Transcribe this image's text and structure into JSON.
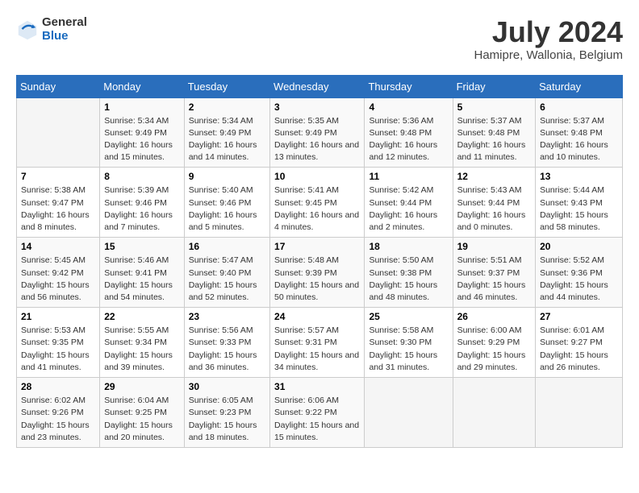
{
  "logo": {
    "general": "General",
    "blue": "Blue"
  },
  "title": {
    "month_year": "July 2024",
    "location": "Hamipre, Wallonia, Belgium"
  },
  "calendar": {
    "headers": [
      "Sunday",
      "Monday",
      "Tuesday",
      "Wednesday",
      "Thursday",
      "Friday",
      "Saturday"
    ],
    "weeks": [
      [
        {
          "day": "",
          "sunrise": "",
          "sunset": "",
          "daylight": ""
        },
        {
          "day": "1",
          "sunrise": "Sunrise: 5:34 AM",
          "sunset": "Sunset: 9:49 PM",
          "daylight": "Daylight: 16 hours and 15 minutes."
        },
        {
          "day": "2",
          "sunrise": "Sunrise: 5:34 AM",
          "sunset": "Sunset: 9:49 PM",
          "daylight": "Daylight: 16 hours and 14 minutes."
        },
        {
          "day": "3",
          "sunrise": "Sunrise: 5:35 AM",
          "sunset": "Sunset: 9:49 PM",
          "daylight": "Daylight: 16 hours and 13 minutes."
        },
        {
          "day": "4",
          "sunrise": "Sunrise: 5:36 AM",
          "sunset": "Sunset: 9:48 PM",
          "daylight": "Daylight: 16 hours and 12 minutes."
        },
        {
          "day": "5",
          "sunrise": "Sunrise: 5:37 AM",
          "sunset": "Sunset: 9:48 PM",
          "daylight": "Daylight: 16 hours and 11 minutes."
        },
        {
          "day": "6",
          "sunrise": "Sunrise: 5:37 AM",
          "sunset": "Sunset: 9:48 PM",
          "daylight": "Daylight: 16 hours and 10 minutes."
        }
      ],
      [
        {
          "day": "7",
          "sunrise": "Sunrise: 5:38 AM",
          "sunset": "Sunset: 9:47 PM",
          "daylight": "Daylight: 16 hours and 8 minutes."
        },
        {
          "day": "8",
          "sunrise": "Sunrise: 5:39 AM",
          "sunset": "Sunset: 9:46 PM",
          "daylight": "Daylight: 16 hours and 7 minutes."
        },
        {
          "day": "9",
          "sunrise": "Sunrise: 5:40 AM",
          "sunset": "Sunset: 9:46 PM",
          "daylight": "Daylight: 16 hours and 5 minutes."
        },
        {
          "day": "10",
          "sunrise": "Sunrise: 5:41 AM",
          "sunset": "Sunset: 9:45 PM",
          "daylight": "Daylight: 16 hours and 4 minutes."
        },
        {
          "day": "11",
          "sunrise": "Sunrise: 5:42 AM",
          "sunset": "Sunset: 9:44 PM",
          "daylight": "Daylight: 16 hours and 2 minutes."
        },
        {
          "day": "12",
          "sunrise": "Sunrise: 5:43 AM",
          "sunset": "Sunset: 9:44 PM",
          "daylight": "Daylight: 16 hours and 0 minutes."
        },
        {
          "day": "13",
          "sunrise": "Sunrise: 5:44 AM",
          "sunset": "Sunset: 9:43 PM",
          "daylight": "Daylight: 15 hours and 58 minutes."
        }
      ],
      [
        {
          "day": "14",
          "sunrise": "Sunrise: 5:45 AM",
          "sunset": "Sunset: 9:42 PM",
          "daylight": "Daylight: 15 hours and 56 minutes."
        },
        {
          "day": "15",
          "sunrise": "Sunrise: 5:46 AM",
          "sunset": "Sunset: 9:41 PM",
          "daylight": "Daylight: 15 hours and 54 minutes."
        },
        {
          "day": "16",
          "sunrise": "Sunrise: 5:47 AM",
          "sunset": "Sunset: 9:40 PM",
          "daylight": "Daylight: 15 hours and 52 minutes."
        },
        {
          "day": "17",
          "sunrise": "Sunrise: 5:48 AM",
          "sunset": "Sunset: 9:39 PM",
          "daylight": "Daylight: 15 hours and 50 minutes."
        },
        {
          "day": "18",
          "sunrise": "Sunrise: 5:50 AM",
          "sunset": "Sunset: 9:38 PM",
          "daylight": "Daylight: 15 hours and 48 minutes."
        },
        {
          "day": "19",
          "sunrise": "Sunrise: 5:51 AM",
          "sunset": "Sunset: 9:37 PM",
          "daylight": "Daylight: 15 hours and 46 minutes."
        },
        {
          "day": "20",
          "sunrise": "Sunrise: 5:52 AM",
          "sunset": "Sunset: 9:36 PM",
          "daylight": "Daylight: 15 hours and 44 minutes."
        }
      ],
      [
        {
          "day": "21",
          "sunrise": "Sunrise: 5:53 AM",
          "sunset": "Sunset: 9:35 PM",
          "daylight": "Daylight: 15 hours and 41 minutes."
        },
        {
          "day": "22",
          "sunrise": "Sunrise: 5:55 AM",
          "sunset": "Sunset: 9:34 PM",
          "daylight": "Daylight: 15 hours and 39 minutes."
        },
        {
          "day": "23",
          "sunrise": "Sunrise: 5:56 AM",
          "sunset": "Sunset: 9:33 PM",
          "daylight": "Daylight: 15 hours and 36 minutes."
        },
        {
          "day": "24",
          "sunrise": "Sunrise: 5:57 AM",
          "sunset": "Sunset: 9:31 PM",
          "daylight": "Daylight: 15 hours and 34 minutes."
        },
        {
          "day": "25",
          "sunrise": "Sunrise: 5:58 AM",
          "sunset": "Sunset: 9:30 PM",
          "daylight": "Daylight: 15 hours and 31 minutes."
        },
        {
          "day": "26",
          "sunrise": "Sunrise: 6:00 AM",
          "sunset": "Sunset: 9:29 PM",
          "daylight": "Daylight: 15 hours and 29 minutes."
        },
        {
          "day": "27",
          "sunrise": "Sunrise: 6:01 AM",
          "sunset": "Sunset: 9:27 PM",
          "daylight": "Daylight: 15 hours and 26 minutes."
        }
      ],
      [
        {
          "day": "28",
          "sunrise": "Sunrise: 6:02 AM",
          "sunset": "Sunset: 9:26 PM",
          "daylight": "Daylight: 15 hours and 23 minutes."
        },
        {
          "day": "29",
          "sunrise": "Sunrise: 6:04 AM",
          "sunset": "Sunset: 9:25 PM",
          "daylight": "Daylight: 15 hours and 20 minutes."
        },
        {
          "day": "30",
          "sunrise": "Sunrise: 6:05 AM",
          "sunset": "Sunset: 9:23 PM",
          "daylight": "Daylight: 15 hours and 18 minutes."
        },
        {
          "day": "31",
          "sunrise": "Sunrise: 6:06 AM",
          "sunset": "Sunset: 9:22 PM",
          "daylight": "Daylight: 15 hours and 15 minutes."
        },
        {
          "day": "",
          "sunrise": "",
          "sunset": "",
          "daylight": ""
        },
        {
          "day": "",
          "sunrise": "",
          "sunset": "",
          "daylight": ""
        },
        {
          "day": "",
          "sunrise": "",
          "sunset": "",
          "daylight": ""
        }
      ]
    ]
  }
}
